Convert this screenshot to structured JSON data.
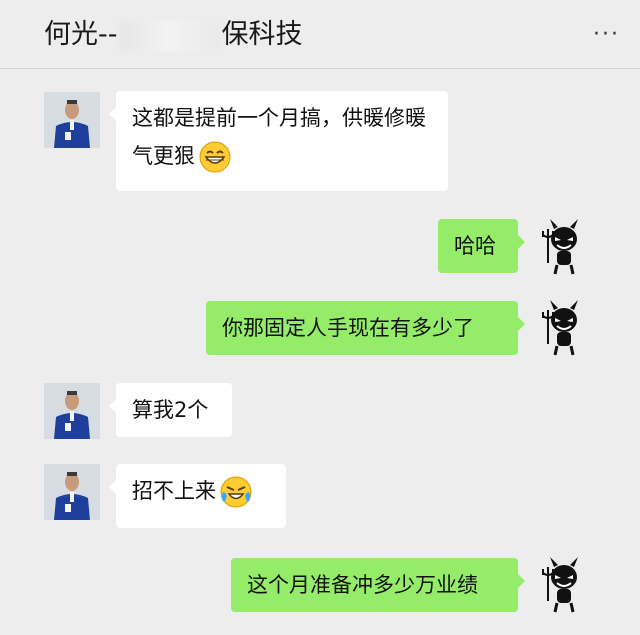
{
  "header": {
    "title_prefix": "何光--",
    "title_suffix": "保科技",
    "more_label": "···"
  },
  "messages": [
    {
      "side": "left",
      "text": "这都是提前一个月搞，供暖修暖气更狠",
      "emoji": "grinning-face-icon"
    },
    {
      "side": "right",
      "text": "哈哈"
    },
    {
      "side": "right",
      "text": "你那固定人手现在有多少了"
    },
    {
      "side": "left",
      "text": "算我2个"
    },
    {
      "side": "left",
      "text": "招不上来",
      "emoji": "loudly-crying-laughing-face-icon"
    },
    {
      "side": "right",
      "text": "这个月准备冲多少万业绩"
    }
  ],
  "colors": {
    "background": "#ededed",
    "incoming_bubble": "#ffffff",
    "outgoing_bubble": "#95ec69"
  }
}
